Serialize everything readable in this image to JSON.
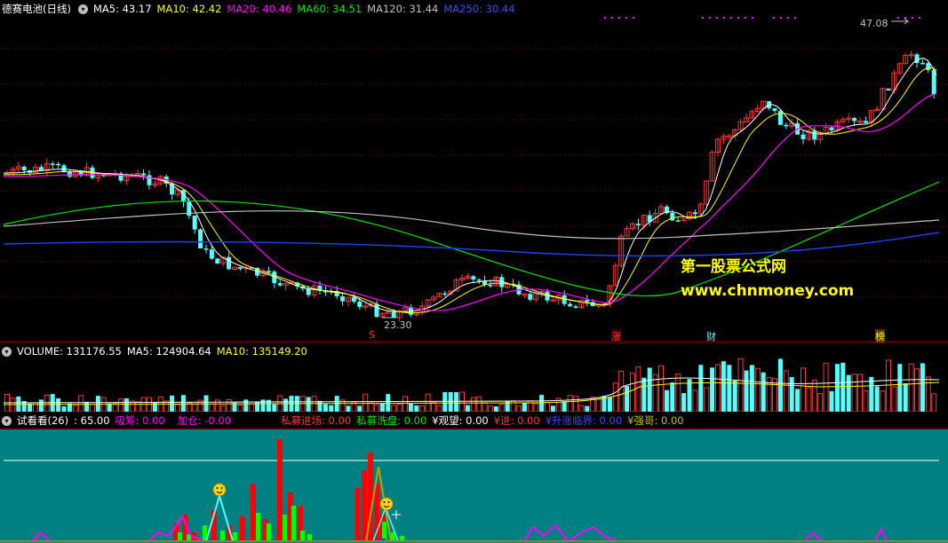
{
  "price_header": {
    "stock_name": "德赛电池(日线)",
    "ma5": "MA5: 43.17",
    "ma10": "MA10: 42.42",
    "ma20": "MA20: 40.46",
    "ma60": "MA60: 34.51",
    "ma120": "MA120: 31.44",
    "ma250": "MA250: 30.44"
  },
  "price_annotations": {
    "high_label": "47.08",
    "low_label": "23.30"
  },
  "event_markers": {
    "s": "S",
    "zhang": "涨",
    "cai": "财",
    "bang": "榜"
  },
  "watermark": {
    "line1": "第一股票公式网",
    "line2": "www.chnmoney.com"
  },
  "volume_header": {
    "volume": "VOLUME: 131176.55",
    "ma5": "MA5: 124904.64",
    "ma10": "MA10: 135149.20"
  },
  "indicator_header": {
    "name": "试看看(26)",
    "value": ": 65.00",
    "xichou": "吸筹: 0.00",
    "jiacang": "加仓: -0.00",
    "simu_jinchang": "私募进场: 0.00",
    "simu_xipan": "私募洗盘: 0.00",
    "guanwang": "¥观望: 0.00",
    "jin": "¥进: 0.00",
    "shengzhang": "¥升涨临界: 0.00",
    "qiangge": "¥强哥: 0.00"
  },
  "colors": {
    "up": "#ff3232",
    "down": "#54ffff",
    "ma5": "#ffffff",
    "ma10": "#ffff00",
    "ma20": "#ff00ff",
    "ma60": "#00e600",
    "ma120": "#c0c0c0",
    "ma250": "#2040ff",
    "indicator_bg": "#008080"
  }
}
